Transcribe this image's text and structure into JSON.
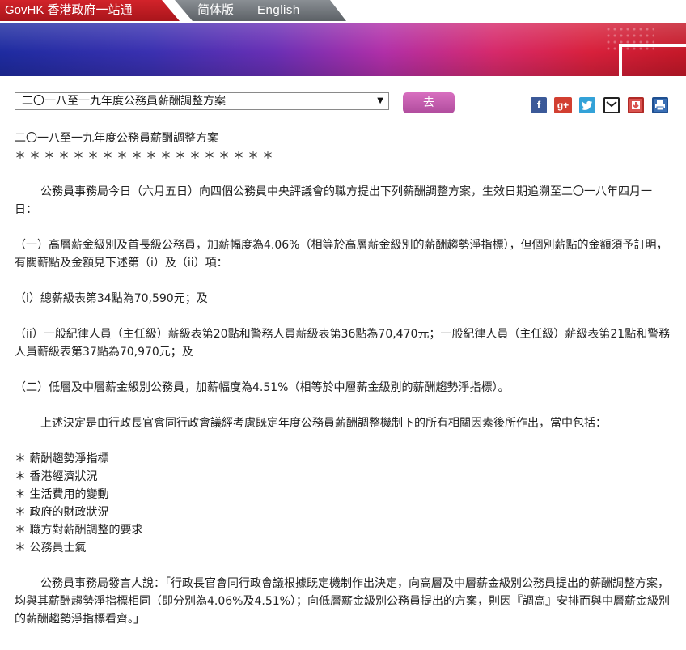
{
  "topnav": {
    "govhk": "GovHK 香港政府一站通",
    "simplified": "简体版",
    "english": "English"
  },
  "selector": {
    "selected": "二〇一八至一九年度公務員薪酬調整方案",
    "go_label": "去"
  },
  "social": {
    "facebook": "f",
    "google_plus": "g+",
    "twitter": "t"
  },
  "article": {
    "title": "二〇一八至一九年度公務員薪酬調整方案",
    "stars": "＊＊＊＊＊＊＊＊＊＊＊＊＊＊＊＊＊＊",
    "para1": "公務員事務局今日（六月五日）向四個公務員中央評議會的職方提出下列薪酬調整方案，生效日期追溯至二〇一八年四月一日：",
    "para2": "（一）高層薪金級別及首長級公務員，加薪幅度為4.06%（相等於高層薪金級別的薪酬趨勢淨指標），但個別薪點的金額須予訂明，有關薪點及金額見下述第（i）及（ii）項：",
    "para3": "（i）總薪級表第34點為70,590元；及",
    "para4": "（ii）一般紀律人員（主任級）薪級表第20點和警務人員薪級表第36點為70,470元；一般紀律人員（主任級）薪級表第21點和警務人員薪級表第37點為70,970元；及",
    "para5": "（二）低層及中層薪金級別公務員，加薪幅度為4.51%（相等於中層薪金級別的薪酬趨勢淨指標）。",
    "para6": "上述決定是由行政長官會同行政會議經考慮既定年度公務員薪酬調整機制下的所有相關因素後所作出，當中包括：",
    "bullets": [
      "＊ 薪酬趨勢淨指標",
      "＊ 香港經濟狀況",
      "＊ 生活費用的變動",
      "＊ 政府的財政狀況",
      "＊ 職方對薪酬調整的要求",
      "＊ 公務員士氣"
    ],
    "para7": "公務員事務局發言人說：「行政長官會同行政會議根據既定機制作出決定，向高層及中層薪金級別公務員提出的薪酬調整方案，均與其薪酬趨勢淨指標相同（即分別為4.06%及4.51%）；向低層薪金級別公務員提出的方案，則因『調高』安排而與中層薪金級別的薪酬趨勢淨指標看齊。」"
  },
  "colors": {
    "govhk_red": "#c81d24",
    "go_button": "#c05aad",
    "facebook": "#3b5998",
    "google_plus": "#d23f31",
    "twitter": "#33a2d8"
  }
}
